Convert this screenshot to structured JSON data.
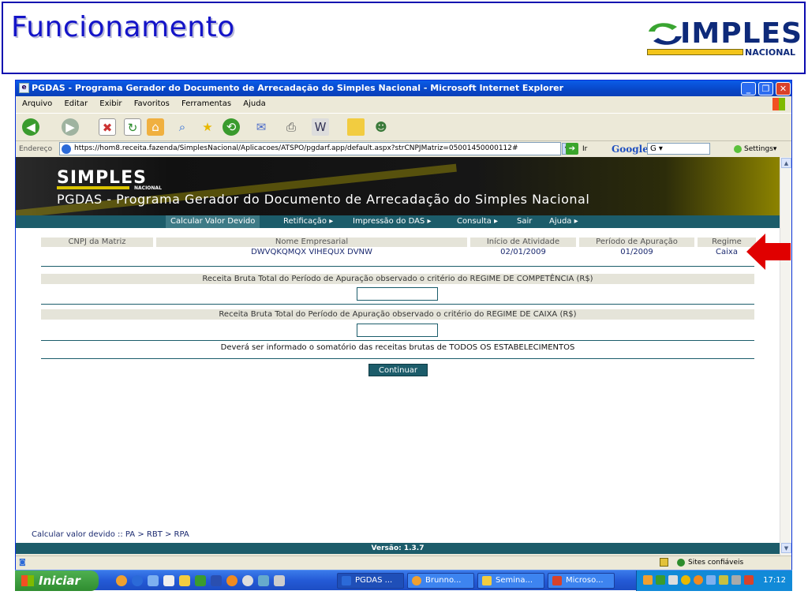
{
  "slide": {
    "title": "Funcionamento",
    "logo_word": "IMPLES",
    "logo_sub": "NACIONAL"
  },
  "browser": {
    "window_title": "PGDAS - Programa Gerador do Documento de Arrecadação do Simples Nacional - Microsoft Internet Explorer",
    "menu": [
      "Arquivo",
      "Editar",
      "Exibir",
      "Favoritos",
      "Ferramentas",
      "Ajuda"
    ],
    "address_label": "Endereço",
    "url": "https://hom8.receita.fazenda/SimplesNacional/Aplicacoes/ATSPO/pgdarf.app/default.aspx?strCNPJMatriz=05001450000112#",
    "go_label": "Ir",
    "search_brand": "Google",
    "search_engine": "G",
    "settings_label": "Settings",
    "status_zone": "Sites confiáveis"
  },
  "page": {
    "logo_word": "IMPLES",
    "logo_sub": "NACIONAL",
    "title": "PGDAS - Programa Gerador do Documento de Arrecadação do Simples Nacional",
    "nav": [
      "Calcular Valor Devido",
      "Retificação ▸",
      "Impressão do DAS ▸",
      "Consulta ▸",
      "Sair",
      "Ajuda ▸"
    ],
    "info": {
      "headers": [
        "CNPJ da Matriz",
        "Nome Empresarial",
        "Início de Atividade",
        "Período de Apuração",
        "Regime"
      ],
      "values": [
        "",
        "DWVQKQMQX VIHEQUX DVNW",
        "02/01/2009",
        "01/2009",
        "Caixa"
      ]
    },
    "receita_competencia_label": "Receita Bruta Total do Período de Apuração observado o critério do REGIME DE COMPETÊNCIA (R$)",
    "receita_competencia_value": "",
    "receita_caixa_label": "Receita Bruta Total do Período de Apuração observado o critério do REGIME DE CAIXA (R$)",
    "receita_caixa_value": "",
    "note": "Deverá ser informado o somatório das receitas brutas de TODOS OS ESTABELECIMENTOS",
    "continue_label": "Continuar",
    "breadcrumb": "Calcular valor devido :: PA > RBT > RPA",
    "version": "Versão: 1.3.7"
  },
  "taskbar": {
    "start_label": "Iniciar",
    "tasks": [
      "PGDAS ...",
      "Brunno...",
      "Semina...",
      "Microso..."
    ],
    "clock": "17:12"
  },
  "colors": {
    "slide_title": "#1414c8",
    "nav_teal": "#1c5c6a",
    "highlight_arrow": "#e00000"
  }
}
